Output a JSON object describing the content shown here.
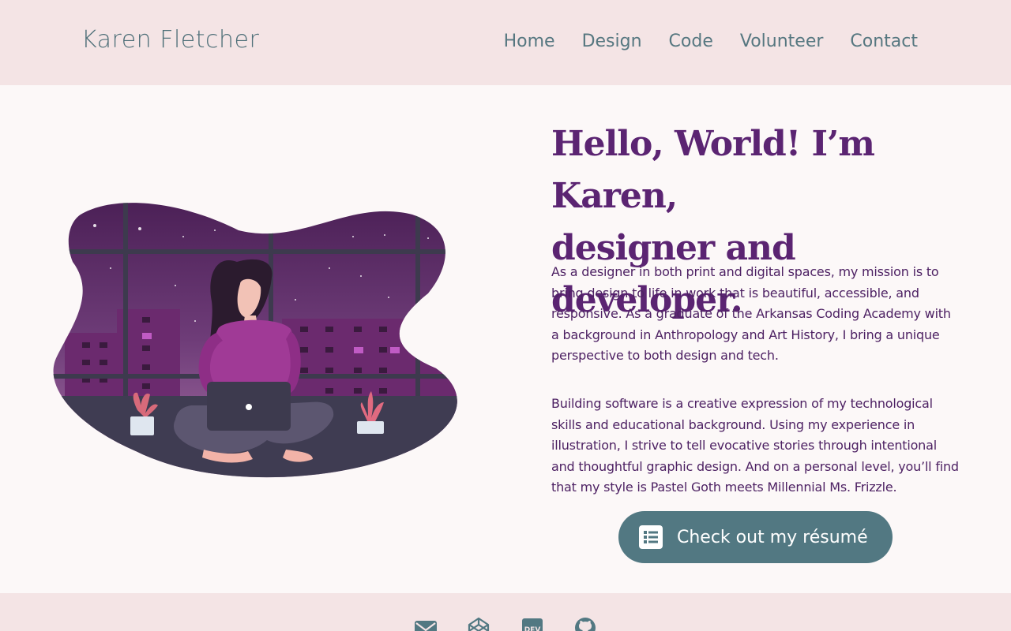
{
  "header": {
    "brand": "Karen Fletcher",
    "nav": [
      "Home",
      "Design",
      "Code",
      "Volunteer",
      "Contact"
    ]
  },
  "main": {
    "headline_line1": "Hello, World! I’m Karen,",
    "headline_line2": "designer and developer.",
    "paragraph1": "As a designer in both print and digital spaces, my mission is to bring design to life in work that is beautiful, accessible, and responsive. As a graduate of the Arkansas Coding Academy with a background in Anthropology and Art History, I bring a unique perspective to both design and tech.",
    "paragraph2": "Building software is a creative expression of my technological skills and educational background. Using my experience in illustration, I strive to tell evocative stories through intentional and thoughtful graphic design. And on a personal level, you’ll find that my style is Pastel Goth meets Millennial Ms. Frizzle.",
    "resume_button": "Check out my résumé"
  },
  "footer": {
    "icons": [
      "email-icon",
      "codepen-icon",
      "dev-icon",
      "github-icon"
    ]
  },
  "colors": {
    "header_bg": "#f4e4e5",
    "accent_purple": "#5b2472",
    "button_teal": "#527882"
  }
}
